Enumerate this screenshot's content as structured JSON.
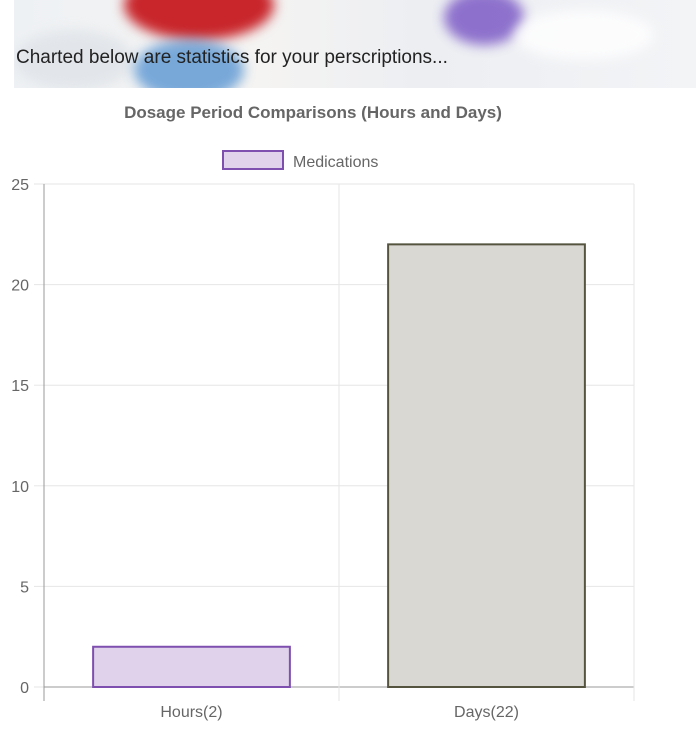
{
  "page": {
    "intro_text": "Charted below are statistics for your perscriptions..."
  },
  "colors": {
    "hours_fill": "#dfd2ea",
    "hours_stroke": "#7f4fb0",
    "days_fill": "#d9d8d3",
    "days_stroke": "#55553f",
    "grid": "#e6e6e6",
    "axis": "#999999",
    "text": "#666666"
  },
  "chart_data": {
    "type": "bar",
    "title": "Dosage Period Comparisons (Hours and Days)",
    "categories": [
      "Hours(2)",
      "Days(22)"
    ],
    "series": [
      {
        "name": "Medications",
        "values": [
          2,
          22
        ]
      }
    ],
    "ylim": [
      0,
      25
    ],
    "yticks": [
      0,
      5,
      10,
      15,
      20,
      25
    ],
    "grid": true,
    "legend": "top"
  }
}
